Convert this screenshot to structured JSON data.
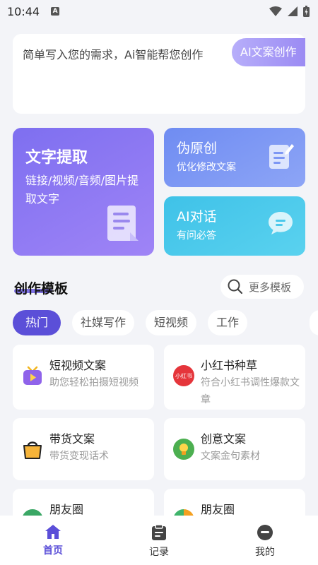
{
  "status_bar": {
    "time": "10:44",
    "indicator": "A"
  },
  "prompt": {
    "placeholder": "简单写入您的需求，Ai智能帮您创作",
    "button_label": "AI文案创作"
  },
  "features": {
    "extract": {
      "title": "文字提取",
      "subtitle": "链接/视频/音频/图片提取文字",
      "icon": "document-icon"
    },
    "rewrite": {
      "title": "伪原创",
      "subtitle": "优化修改文案",
      "icon": "edit-doc-icon"
    },
    "chat": {
      "title": "AI对话",
      "subtitle": "有问必答",
      "icon": "chat-bubble-icon"
    }
  },
  "templates_section": {
    "title": "创作模板",
    "more_label": "更多模板"
  },
  "tabs": [
    {
      "label": "热门",
      "active": true
    },
    {
      "label": "社媒写作",
      "active": false
    },
    {
      "label": "短视频",
      "active": false
    },
    {
      "label": "工作",
      "active": false
    }
  ],
  "templates": [
    {
      "name": "短视频文案",
      "desc": "助您轻松拍摄短视频",
      "icon": "tv-icon"
    },
    {
      "name": "小红书种草",
      "desc": "符合小红书调性爆款文章",
      "icon": "xiaohongshu-icon",
      "icon_text": "小红书"
    },
    {
      "name": "带货文案",
      "desc": "带货变现话术",
      "icon": "shopping-bag-icon"
    },
    {
      "name": "创意文案",
      "desc": "文案金句素材",
      "icon": "lightbulb-icon"
    },
    {
      "name": "朋友圈",
      "desc": "",
      "icon": "moments-icon"
    },
    {
      "name": "朋友圈",
      "desc": "",
      "icon": "aperture-icon"
    }
  ],
  "nav": [
    {
      "label": "首页",
      "icon": "home-icon",
      "active": true
    },
    {
      "label": "记录",
      "icon": "clipboard-icon",
      "active": false
    },
    {
      "label": "我的",
      "icon": "profile-icon",
      "active": false
    }
  ],
  "colors": {
    "primary": "#5b4fd8",
    "extract_card": "#8a78f3",
    "rewrite_card": "#7d97f4",
    "chat_card": "#4bc8eb",
    "background": "#f3f4f8"
  }
}
